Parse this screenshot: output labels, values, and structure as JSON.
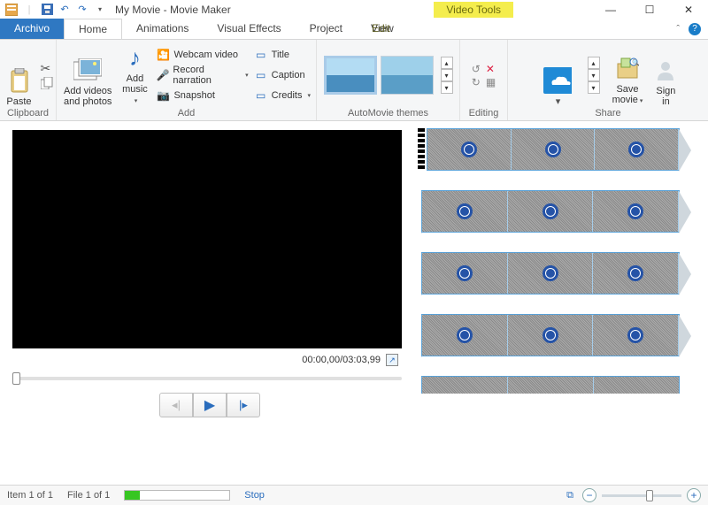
{
  "title": "My Movie - Movie Maker",
  "context_tab": "Video Tools",
  "context_sub": "Edit",
  "tabs": {
    "file": "Archivo",
    "home": "Home",
    "anim": "Animations",
    "vfx": "Visual Effects",
    "proj": "Project",
    "view": "View"
  },
  "ribbon": {
    "clipboard": {
      "paste": "Paste",
      "label": "Clipboard"
    },
    "add": {
      "addvideos": "Add videos\nand photos",
      "addmusic": "Add\nmusic",
      "webcam": "Webcam video",
      "record": "Record narration",
      "snapshot": "Snapshot",
      "title": "Title",
      "caption": "Caption",
      "credits": "Credits",
      "label": "Add"
    },
    "themes": {
      "label": "AutoMovie themes"
    },
    "editing": {
      "label": "Editing"
    },
    "share": {
      "save": "Save\nmovie",
      "signin": "Sign\nin",
      "label": "Share"
    }
  },
  "player": {
    "timecode": "00:00,00/03:03,99"
  },
  "status": {
    "item": "Item 1 of 1",
    "file": "File 1 of 1",
    "stop": "Stop"
  }
}
